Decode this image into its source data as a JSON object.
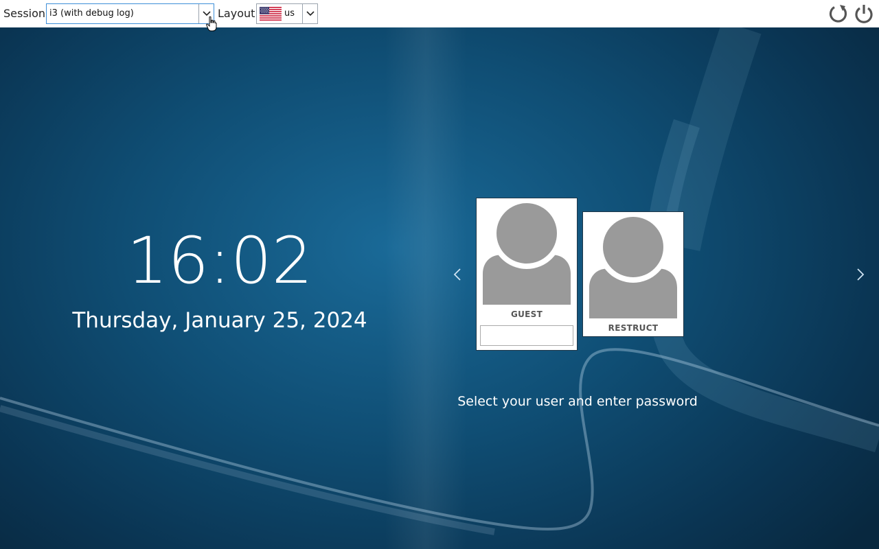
{
  "topbar": {
    "session_label": "Session",
    "session_value": "i3 (with debug log)",
    "layout_label": "Layout",
    "layout_value": "us",
    "layout_flag_icon": "us-flag-icon",
    "reboot_icon": "reboot-icon",
    "power_icon": "power-icon"
  },
  "clock": {
    "time": "16:02",
    "date": "Thursday, January 25, 2024"
  },
  "users": [
    {
      "name": "GUEST",
      "selected": true,
      "password_value": ""
    },
    {
      "name": "RESTRUCT",
      "selected": false
    }
  ],
  "prompt": "Select your user and enter password",
  "colors": {
    "background": "#0f4d73",
    "topbar": "#ffffff",
    "icon_gray": "#555555",
    "avatar_gray": "#9a9a9a",
    "focus_border": "#3c8ed8"
  }
}
